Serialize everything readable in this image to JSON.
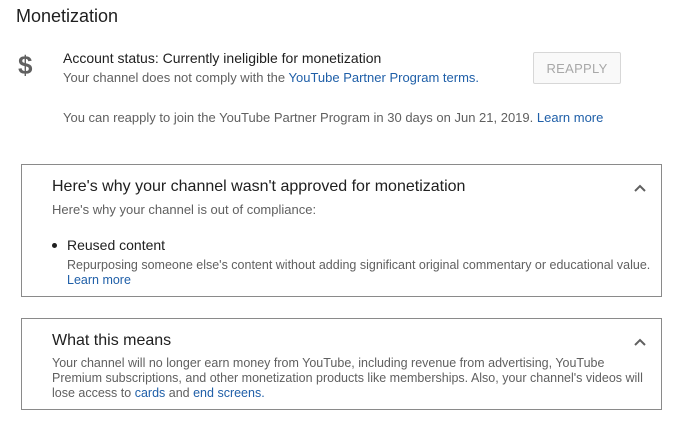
{
  "page": {
    "title": "Monetization"
  },
  "account": {
    "icon": "dollar-icon",
    "icon_glyph": "$",
    "status_label": "Account status:",
    "status_value": "Currently ineligible for monetization",
    "compliance_text": "Your channel does not comply with the",
    "compliance_link": "YouTube Partner Program terms.",
    "reapply_text": "You can reapply to join the YouTube Partner Program in 30 days on Jun 21, 2019.",
    "reapply_link": "Learn more",
    "reapply_button": "REAPPLY"
  },
  "reasons_card": {
    "title": "Here's why your channel wasn't approved for monetization",
    "subtitle": "Here's why your channel is out of compliance:",
    "items": [
      {
        "label": "Reused content",
        "description": "Repurposing someone else's content without adding significant original commentary or educational value.",
        "link": "Learn more"
      }
    ]
  },
  "means_card": {
    "title": "What this means",
    "text": "Your channel will no longer earn money from YouTube, including revenue from advertising, YouTube Premium subscriptions, and other monetization products like memberships. Also, your channel's videos will lose access to",
    "link_1": "cards",
    "connector": "and",
    "link_2": "end screens."
  },
  "colors": {
    "link": "#1f5fa8",
    "secondary_text": "#606060",
    "border": "#8a8a8a"
  }
}
